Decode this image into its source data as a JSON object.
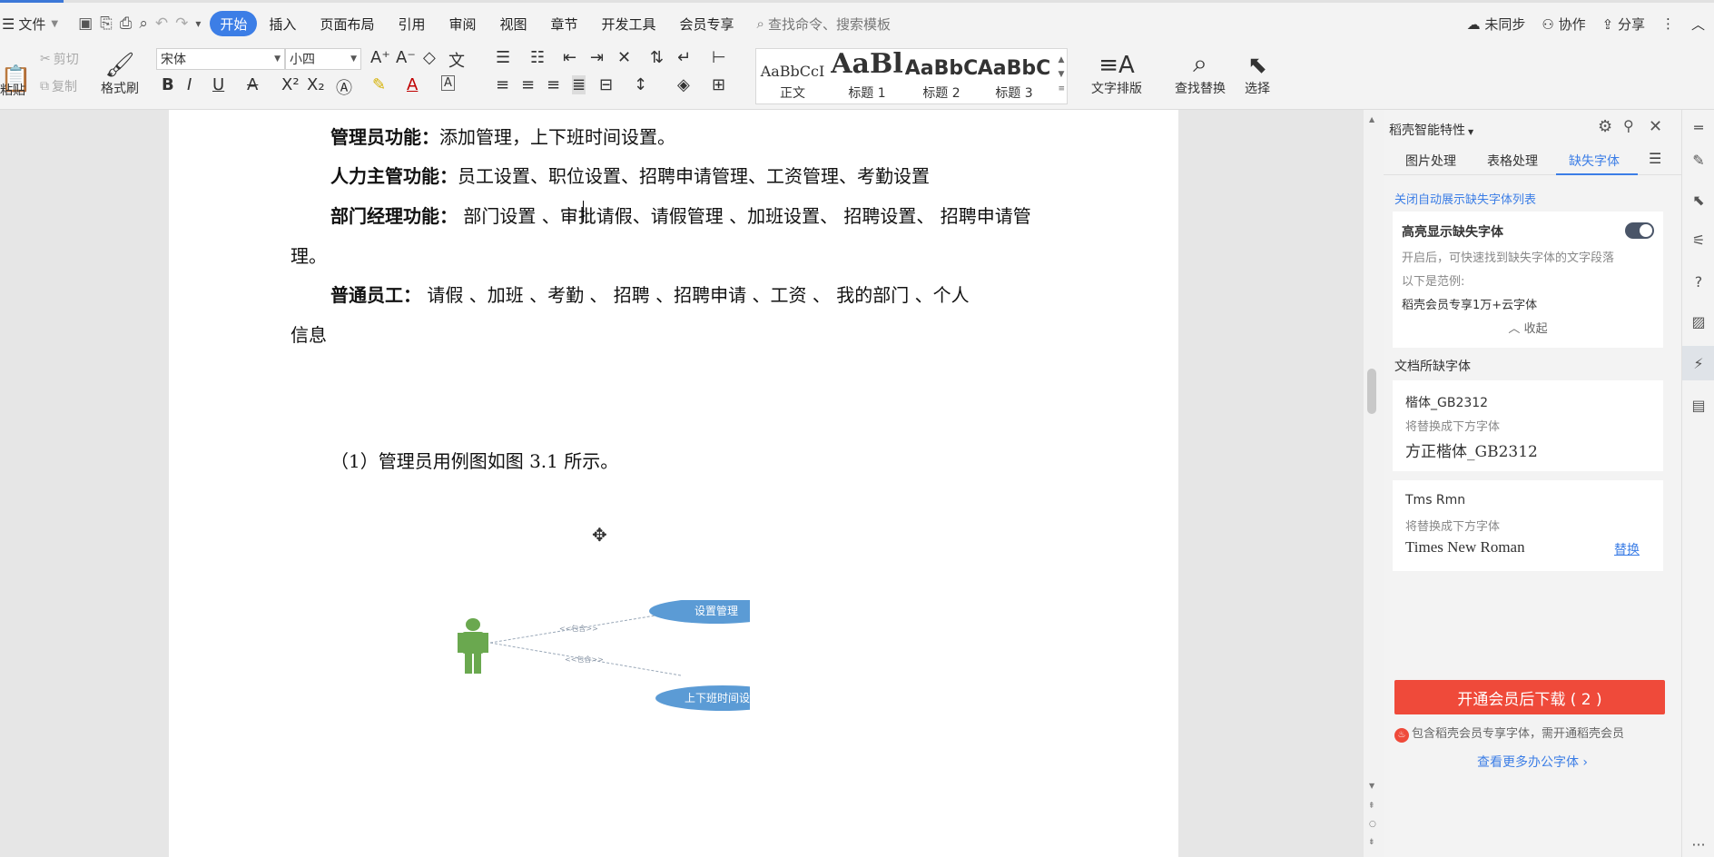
{
  "menubar": {
    "file_label": "文件",
    "tabs": [
      "开始",
      "插入",
      "页面布局",
      "引用",
      "审阅",
      "视图",
      "章节",
      "开发工具",
      "会员专享"
    ],
    "search_placeholder": "查找命令、搜索模板",
    "right": {
      "sync": "未同步",
      "collab": "协作",
      "share": "分享"
    }
  },
  "ribbon": {
    "paste": "粘贴",
    "cut": "剪切",
    "copy": "复制",
    "format_painter": "格式刷",
    "font_name": "宋体",
    "font_size": "小四",
    "styles": [
      {
        "preview": "AaBbCcI",
        "name": "正文"
      },
      {
        "preview": "AaBl",
        "name": "标题 1"
      },
      {
        "preview": "AaBbC",
        "name": "标题 2"
      },
      {
        "preview": "AaBbC",
        "name": "标题 3"
      }
    ],
    "text_layout": "文字排版",
    "find_replace": "查找替换",
    "select": "选择"
  },
  "document": {
    "p1_bold": "管理员功能：",
    "p1_text": "添加管理，上下班时间设置。",
    "p2_bold": "人力主管功能：",
    "p2_text": "员工设置、职位设置、招聘申请管理、工资管理、考勤设置",
    "p3_bold": "部门经理功能：",
    "p3_text": " 部门设置 、审批请假、请假管理 、加班设置、 招聘设置、 招聘申请管",
    "p3_cont": "理。",
    "p4_bold": "普通员工：",
    "p4_text": " 请假 、加班 、考勤 、 招聘  、招聘申请  、工资 、 我的部门  、个人",
    "p4_cont": "信息",
    "caption": "（1）管理员用例图如图 3.1 所示。",
    "diagram": {
      "usecase1": "设置管理",
      "usecase2": "上下班时间设置",
      "include1": "<<包含>>",
      "include2": "<<包含>>"
    }
  },
  "panel": {
    "title": "稻壳智能特性",
    "tabs": [
      "图片处理",
      "表格处理",
      "缺失字体"
    ],
    "close_auto": "关闭自动展示缺失字体列表",
    "highlight_title": "高亮显示缺失字体",
    "highlight_desc": "开启后，可快速找到缺失字体的文字段落",
    "example_label": "以下是范例:",
    "example_value": "稻壳会员专享1万+云字体",
    "collapse": "收起",
    "missing_title": "文档所缺字体",
    "font1": {
      "missing": "楷体_GB2312",
      "replace_label": "将替换成下方字体",
      "replacement": "方正楷体_GB2312"
    },
    "font2": {
      "missing": "Tms Rmn",
      "replace_label": "将替换成下方字体",
      "replacement": "Times New Roman",
      "action": "替换"
    },
    "vip_button": "开通会员后下载 ( 2 )",
    "vip_note": "包含稻壳会员专享字体，需开通稻壳会员",
    "more_fonts": "查看更多办公字体"
  },
  "colors": {
    "accent": "#3c7ee6",
    "vip": "#ef4a3a",
    "actor": "#6aa84f",
    "usecase": "#5b9bd5"
  }
}
